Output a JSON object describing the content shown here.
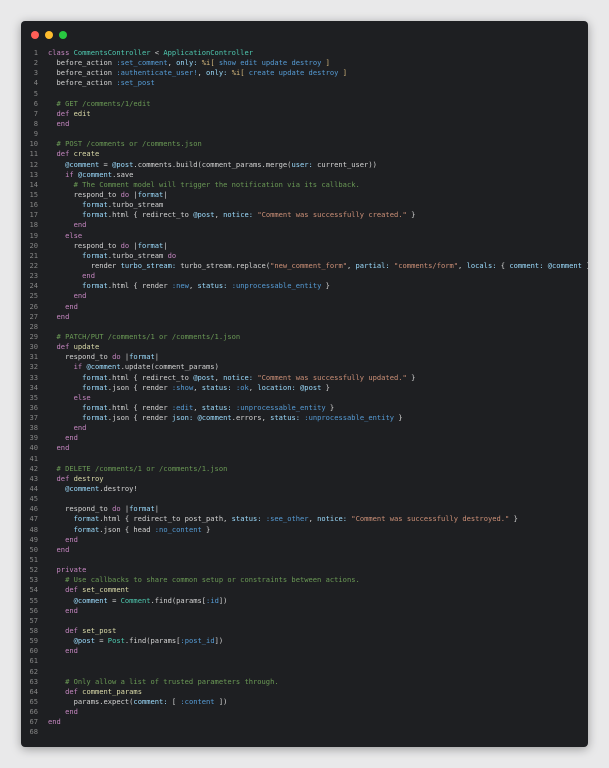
{
  "window": {
    "buttons": [
      "close",
      "minimize",
      "maximize"
    ]
  },
  "colors": {
    "background": "#1e1f22",
    "keyword": "#c586c0",
    "class": "#4ec9b0",
    "symbol": "#569cd6",
    "string": "#ce9178",
    "comment": "#6a9955",
    "ivar": "#9cdcfe",
    "line_number": "#858585"
  },
  "editor": {
    "language": "ruby",
    "lines": [
      [
        [
          "kw",
          "class "
        ],
        [
          "cls",
          "CommentsController"
        ],
        [
          "plain",
          " < "
        ],
        [
          "cls",
          "ApplicationController"
        ]
      ],
      [
        [
          "plain",
          "  before_action "
        ],
        [
          "sym",
          ":set_comment"
        ],
        [
          "plain",
          ", "
        ],
        [
          "key",
          "only:"
        ],
        [
          "plain",
          " "
        ],
        [
          "pct",
          "%i["
        ],
        [
          "sym",
          " show edit update destroy "
        ],
        [
          "pct",
          "]"
        ]
      ],
      [
        [
          "plain",
          "  before_action "
        ],
        [
          "sym",
          ":authenticate_user!"
        ],
        [
          "plain",
          ", "
        ],
        [
          "key",
          "only:"
        ],
        [
          "plain",
          " "
        ],
        [
          "pct",
          "%i["
        ],
        [
          "sym",
          " create update destroy "
        ],
        [
          "pct",
          "]"
        ]
      ],
      [
        [
          "plain",
          "  before_action "
        ],
        [
          "sym",
          ":set_post"
        ]
      ],
      [
        [
          "plain",
          ""
        ]
      ],
      [
        [
          "cmt",
          "  # GET /comments/1/edit"
        ]
      ],
      [
        [
          "kw",
          "  def "
        ],
        [
          "fn",
          "edit"
        ]
      ],
      [
        [
          "kw",
          "  end"
        ]
      ],
      [
        [
          "plain",
          ""
        ]
      ],
      [
        [
          "cmt",
          "  # POST /comments or /comments.json"
        ]
      ],
      [
        [
          "kw",
          "  def "
        ],
        [
          "fn",
          "create"
        ]
      ],
      [
        [
          "ivar",
          "    @comment"
        ],
        [
          "plain",
          " = "
        ],
        [
          "ivar",
          "@post"
        ],
        [
          "plain",
          ".comments.build(comment_params.merge("
        ],
        [
          "key",
          "user:"
        ],
        [
          "plain",
          " current_user))"
        ]
      ],
      [
        [
          "kw",
          "    if "
        ],
        [
          "ivar",
          "@comment"
        ],
        [
          "plain",
          ".save"
        ]
      ],
      [
        [
          "cmt",
          "      # The Comment model will trigger the notification via its callback."
        ]
      ],
      [
        [
          "plain",
          "      respond_to "
        ],
        [
          "kw",
          "do"
        ],
        [
          "plain",
          " |"
        ],
        [
          "ivar",
          "format"
        ],
        [
          "plain",
          "|"
        ]
      ],
      [
        [
          "plain",
          "        "
        ],
        [
          "ivar",
          "format"
        ],
        [
          "plain",
          ".turbo_stream"
        ]
      ],
      [
        [
          "plain",
          "        "
        ],
        [
          "ivar",
          "format"
        ],
        [
          "plain",
          ".html { redirect_to "
        ],
        [
          "ivar",
          "@post"
        ],
        [
          "plain",
          ", "
        ],
        [
          "key",
          "notice:"
        ],
        [
          "plain",
          " "
        ],
        [
          "str",
          "\"Comment was successfully created.\""
        ],
        [
          "plain",
          " }"
        ]
      ],
      [
        [
          "kw",
          "      end"
        ]
      ],
      [
        [
          "kw",
          "    else"
        ]
      ],
      [
        [
          "plain",
          "      respond_to "
        ],
        [
          "kw",
          "do"
        ],
        [
          "plain",
          " |"
        ],
        [
          "ivar",
          "format"
        ],
        [
          "plain",
          "|"
        ]
      ],
      [
        [
          "plain",
          "        "
        ],
        [
          "ivar",
          "format"
        ],
        [
          "plain",
          ".turbo_stream "
        ],
        [
          "kw",
          "do"
        ]
      ],
      [
        [
          "plain",
          "          render "
        ],
        [
          "key",
          "turbo_stream:"
        ],
        [
          "plain",
          " turbo_stream.replace("
        ],
        [
          "str",
          "\"new_comment_form\""
        ],
        [
          "plain",
          ", "
        ],
        [
          "key",
          "partial:"
        ],
        [
          "plain",
          " "
        ],
        [
          "str",
          "\"comments/form\""
        ],
        [
          "plain",
          ", "
        ],
        [
          "key",
          "locals:"
        ],
        [
          "plain",
          " { "
        ],
        [
          "key",
          "comment:"
        ],
        [
          "plain",
          " "
        ],
        [
          "ivar",
          "@comment"
        ],
        [
          "plain",
          " })"
        ]
      ],
      [
        [
          "kw",
          "        end"
        ]
      ],
      [
        [
          "plain",
          "        "
        ],
        [
          "ivar",
          "format"
        ],
        [
          "plain",
          ".html { render "
        ],
        [
          "sym",
          ":new"
        ],
        [
          "plain",
          ", "
        ],
        [
          "key",
          "status:"
        ],
        [
          "plain",
          " "
        ],
        [
          "sym",
          ":unprocessable_entity"
        ],
        [
          "plain",
          " }"
        ]
      ],
      [
        [
          "kw",
          "      end"
        ]
      ],
      [
        [
          "kw",
          "    end"
        ]
      ],
      [
        [
          "kw",
          "  end"
        ]
      ],
      [
        [
          "plain",
          ""
        ]
      ],
      [
        [
          "cmt",
          "  # PATCH/PUT /comments/1 or /comments/1.json"
        ]
      ],
      [
        [
          "kw",
          "  def "
        ],
        [
          "fn",
          "update"
        ]
      ],
      [
        [
          "plain",
          "    respond_to "
        ],
        [
          "kw",
          "do"
        ],
        [
          "plain",
          " |"
        ],
        [
          "ivar",
          "format"
        ],
        [
          "plain",
          "|"
        ]
      ],
      [
        [
          "kw",
          "      if "
        ],
        [
          "ivar",
          "@comment"
        ],
        [
          "plain",
          ".update(comment_params)"
        ]
      ],
      [
        [
          "plain",
          "        "
        ],
        [
          "ivar",
          "format"
        ],
        [
          "plain",
          ".html { redirect_to "
        ],
        [
          "ivar",
          "@post"
        ],
        [
          "plain",
          ", "
        ],
        [
          "key",
          "notice:"
        ],
        [
          "plain",
          " "
        ],
        [
          "str",
          "\"Comment was successfully updated.\""
        ],
        [
          "plain",
          " }"
        ]
      ],
      [
        [
          "plain",
          "        "
        ],
        [
          "ivar",
          "format"
        ],
        [
          "plain",
          ".json { render "
        ],
        [
          "sym",
          ":show"
        ],
        [
          "plain",
          ", "
        ],
        [
          "key",
          "status:"
        ],
        [
          "plain",
          " "
        ],
        [
          "sym",
          ":ok"
        ],
        [
          "plain",
          ", "
        ],
        [
          "key",
          "location:"
        ],
        [
          "plain",
          " "
        ],
        [
          "ivar",
          "@post"
        ],
        [
          "plain",
          " }"
        ]
      ],
      [
        [
          "kw",
          "      else"
        ]
      ],
      [
        [
          "plain",
          "        "
        ],
        [
          "ivar",
          "format"
        ],
        [
          "plain",
          ".html { render "
        ],
        [
          "sym",
          ":edit"
        ],
        [
          "plain",
          ", "
        ],
        [
          "key",
          "status:"
        ],
        [
          "plain",
          " "
        ],
        [
          "sym",
          ":unprocessable_entity"
        ],
        [
          "plain",
          " }"
        ]
      ],
      [
        [
          "plain",
          "        "
        ],
        [
          "ivar",
          "format"
        ],
        [
          "plain",
          ".json { render "
        ],
        [
          "key",
          "json:"
        ],
        [
          "plain",
          " "
        ],
        [
          "ivar",
          "@comment"
        ],
        [
          "plain",
          ".errors, "
        ],
        [
          "key",
          "status:"
        ],
        [
          "plain",
          " "
        ],
        [
          "sym",
          ":unprocessable_entity"
        ],
        [
          "plain",
          " }"
        ]
      ],
      [
        [
          "kw",
          "      end"
        ]
      ],
      [
        [
          "kw",
          "    end"
        ]
      ],
      [
        [
          "kw",
          "  end"
        ]
      ],
      [
        [
          "plain",
          ""
        ]
      ],
      [
        [
          "cmt",
          "  # DELETE /comments/1 or /comments/1.json"
        ]
      ],
      [
        [
          "kw",
          "  def "
        ],
        [
          "fn",
          "destroy"
        ]
      ],
      [
        [
          "ivar",
          "    @comment"
        ],
        [
          "plain",
          ".destroy!"
        ]
      ],
      [
        [
          "plain",
          ""
        ]
      ],
      [
        [
          "plain",
          "    respond_to "
        ],
        [
          "kw",
          "do"
        ],
        [
          "plain",
          " |"
        ],
        [
          "ivar",
          "format"
        ],
        [
          "plain",
          "|"
        ]
      ],
      [
        [
          "plain",
          "      "
        ],
        [
          "ivar",
          "format"
        ],
        [
          "plain",
          ".html { redirect_to post_path, "
        ],
        [
          "key",
          "status:"
        ],
        [
          "plain",
          " "
        ],
        [
          "sym",
          ":see_other"
        ],
        [
          "plain",
          ", "
        ],
        [
          "key",
          "notice:"
        ],
        [
          "plain",
          " "
        ],
        [
          "str",
          "\"Comment was successfully destroyed.\""
        ],
        [
          "plain",
          " }"
        ]
      ],
      [
        [
          "plain",
          "      "
        ],
        [
          "ivar",
          "format"
        ],
        [
          "plain",
          ".json { head "
        ],
        [
          "sym",
          ":no_content"
        ],
        [
          "plain",
          " }"
        ]
      ],
      [
        [
          "kw",
          "    end"
        ]
      ],
      [
        [
          "kw",
          "  end"
        ]
      ],
      [
        [
          "plain",
          ""
        ]
      ],
      [
        [
          "kw",
          "  private"
        ]
      ],
      [
        [
          "cmt",
          "    # Use callbacks to share common setup or constraints between actions."
        ]
      ],
      [
        [
          "kw",
          "    def "
        ],
        [
          "fn",
          "set_comment"
        ]
      ],
      [
        [
          "ivar",
          "      @comment"
        ],
        [
          "plain",
          " = "
        ],
        [
          "cls",
          "Comment"
        ],
        [
          "plain",
          ".find(params["
        ],
        [
          "sym",
          ":id"
        ],
        [
          "plain",
          "])"
        ]
      ],
      [
        [
          "kw",
          "    end"
        ]
      ],
      [
        [
          "plain",
          ""
        ]
      ],
      [
        [
          "kw",
          "    def "
        ],
        [
          "fn",
          "set_post"
        ]
      ],
      [
        [
          "ivar",
          "      @post"
        ],
        [
          "plain",
          " = "
        ],
        [
          "cls",
          "Post"
        ],
        [
          "plain",
          ".find(params["
        ],
        [
          "sym",
          ":post_id"
        ],
        [
          "plain",
          "])"
        ]
      ],
      [
        [
          "kw",
          "    end"
        ]
      ],
      [
        [
          "plain",
          ""
        ]
      ],
      [
        [
          "plain",
          ""
        ]
      ],
      [
        [
          "cmt",
          "    # Only allow a list of trusted parameters through."
        ]
      ],
      [
        [
          "kw",
          "    def "
        ],
        [
          "fn",
          "comment_params"
        ]
      ],
      [
        [
          "plain",
          "      params.expect("
        ],
        [
          "key",
          "comment:"
        ],
        [
          "plain",
          " [ "
        ],
        [
          "sym",
          ":content"
        ],
        [
          "plain",
          " ])"
        ]
      ],
      [
        [
          "kw",
          "    end"
        ]
      ],
      [
        [
          "kw",
          "end"
        ]
      ],
      [
        [
          "plain",
          ""
        ]
      ]
    ]
  }
}
